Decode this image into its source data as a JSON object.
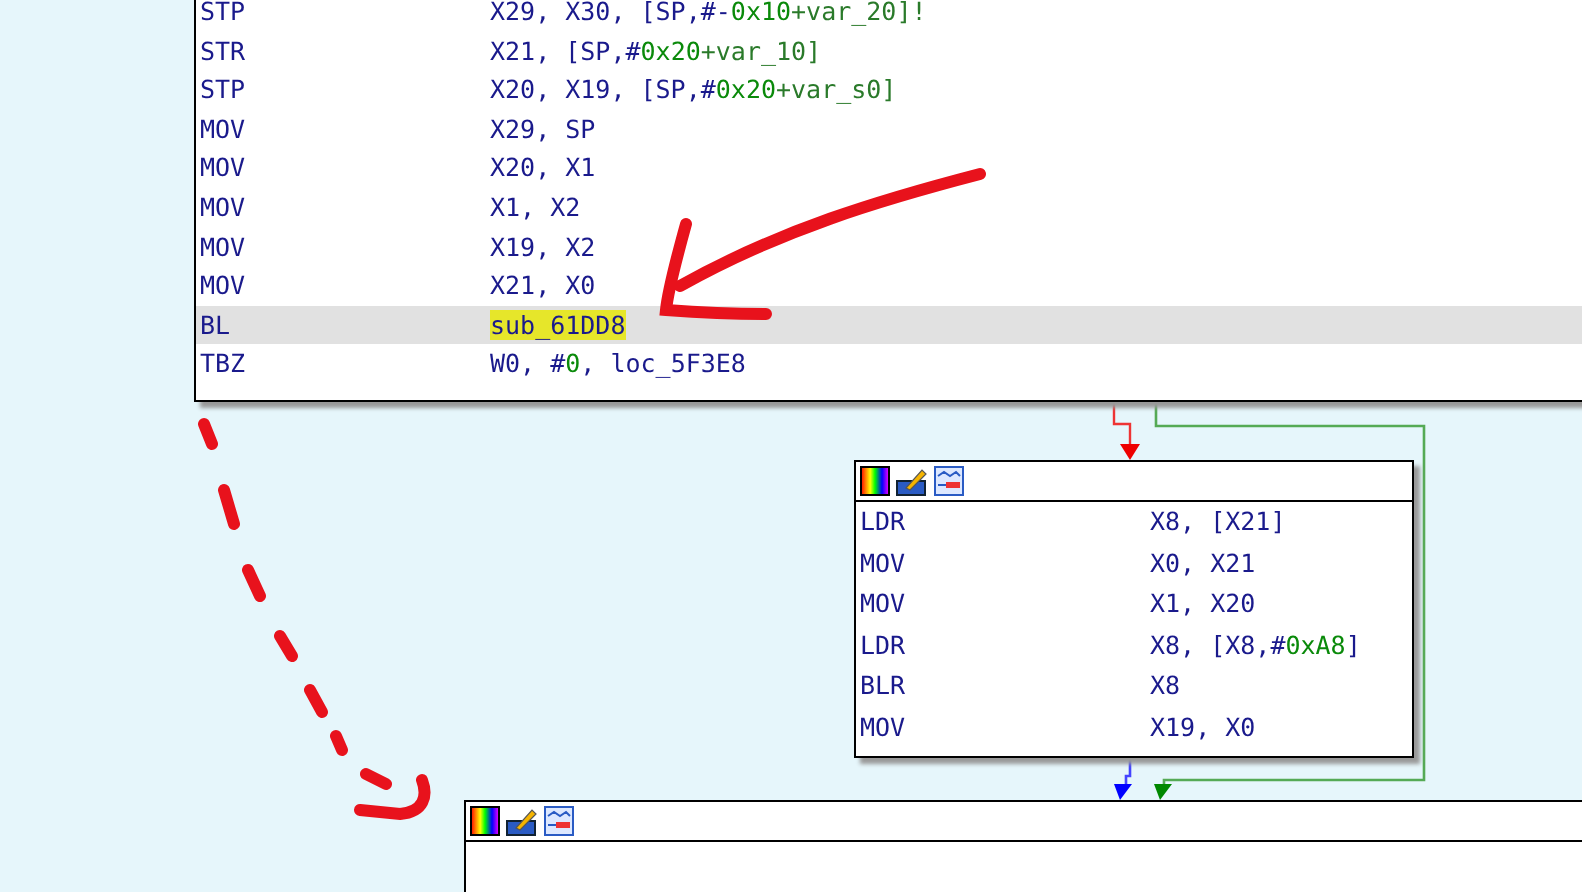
{
  "nodes": [
    {
      "kind": "top",
      "header": false,
      "rows": [
        {
          "mnemonic": "STP",
          "selected": false,
          "operand": [
            {
              "text": "X29, X30, [SP,#-",
              "kind": "plain"
            },
            {
              "text": "0x10",
              "kind": "number"
            },
            {
              "text": "+var_20]!",
              "kind": "var"
            }
          ]
        },
        {
          "mnemonic": "STR",
          "selected": false,
          "operand": [
            {
              "text": "X21, [SP,#",
              "kind": "plain"
            },
            {
              "text": "0x20",
              "kind": "number"
            },
            {
              "text": "+var_10]",
              "kind": "var"
            }
          ]
        },
        {
          "mnemonic": "STP",
          "selected": false,
          "operand": [
            {
              "text": "X20, X19, [SP,#",
              "kind": "plain"
            },
            {
              "text": "0x20",
              "kind": "number"
            },
            {
              "text": "+var_s0]",
              "kind": "var"
            }
          ]
        },
        {
          "mnemonic": "MOV",
          "selected": false,
          "operand": [
            {
              "text": "X29, SP",
              "kind": "plain"
            }
          ]
        },
        {
          "mnemonic": "MOV",
          "selected": false,
          "operand": [
            {
              "text": "X20, X1",
              "kind": "plain"
            }
          ]
        },
        {
          "mnemonic": "MOV",
          "selected": false,
          "operand": [
            {
              "text": "X1, X2",
              "kind": "plain"
            }
          ]
        },
        {
          "mnemonic": "MOV",
          "selected": false,
          "operand": [
            {
              "text": "X19, X2",
              "kind": "plain"
            }
          ]
        },
        {
          "mnemonic": "MOV",
          "selected": false,
          "operand": [
            {
              "text": "X21, X0",
              "kind": "plain"
            }
          ]
        },
        {
          "mnemonic": "BL",
          "selected": true,
          "operand": [
            {
              "text": "sub_61DD8",
              "kind": "highlight"
            }
          ]
        },
        {
          "mnemonic": "TBZ",
          "selected": false,
          "operand": [
            {
              "text": "W0, #",
              "kind": "plain"
            },
            {
              "text": "0",
              "kind": "number"
            },
            {
              "text": ", loc_5F3E8",
              "kind": "plain"
            }
          ]
        }
      ]
    },
    {
      "kind": "middle",
      "header": true,
      "rows": [
        {
          "mnemonic": "LDR",
          "selected": false,
          "operand": [
            {
              "text": "X8, [X21]",
              "kind": "plain"
            }
          ]
        },
        {
          "mnemonic": "MOV",
          "selected": false,
          "operand": [
            {
              "text": "X0, X21",
              "kind": "plain"
            }
          ]
        },
        {
          "mnemonic": "MOV",
          "selected": false,
          "operand": [
            {
              "text": "X1, X20",
              "kind": "plain"
            }
          ]
        },
        {
          "mnemonic": "LDR",
          "selected": false,
          "operand": [
            {
              "text": "X8, [X8,#",
              "kind": "plain"
            },
            {
              "text": "0xA8",
              "kind": "number"
            },
            {
              "text": "]",
              "kind": "plain"
            }
          ]
        },
        {
          "mnemonic": "BLR",
          "selected": false,
          "operand": [
            {
              "text": "X8",
              "kind": "plain"
            }
          ]
        },
        {
          "mnemonic": "MOV",
          "selected": false,
          "operand": [
            {
              "text": "X19, X0",
              "kind": "plain"
            }
          ]
        }
      ]
    },
    {
      "kind": "bottom",
      "header": true
    }
  ]
}
